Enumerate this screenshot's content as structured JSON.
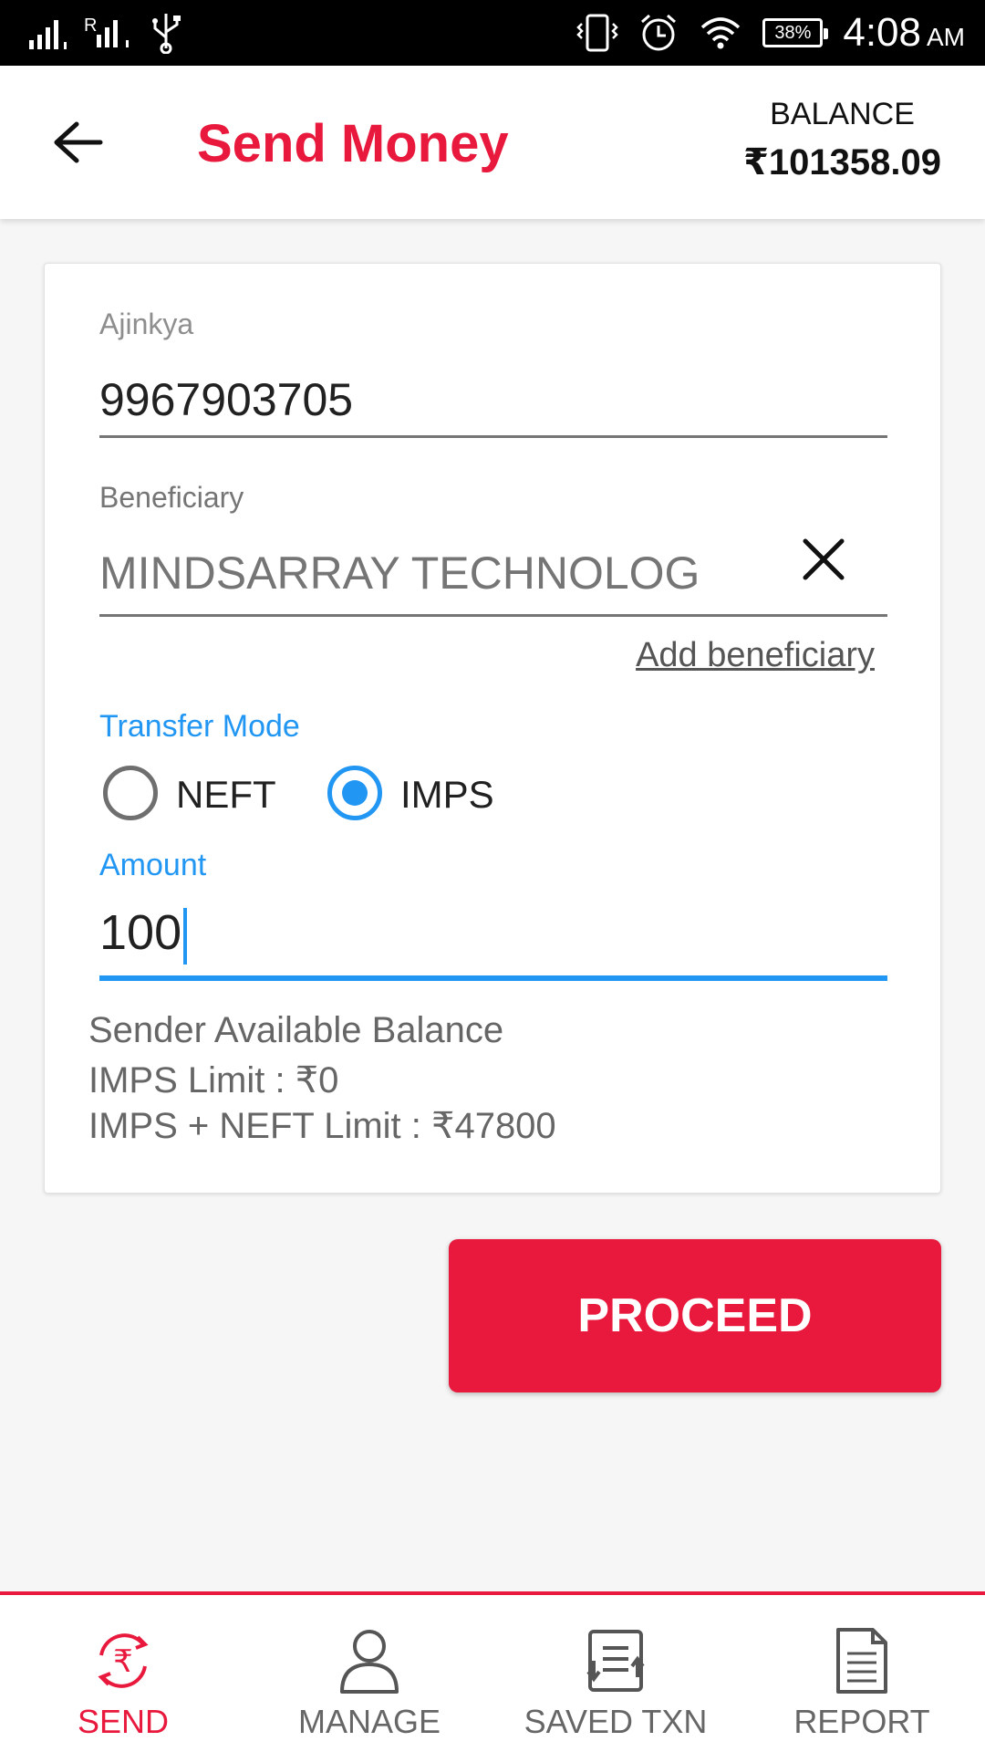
{
  "status_bar": {
    "battery": "38%",
    "time": "4:08",
    "ampm": "AM"
  },
  "app_bar": {
    "title": "Send Money",
    "balance_label": "BALANCE",
    "balance_value": "₹101358.09"
  },
  "form": {
    "sender_label": "Ajinkya",
    "sender_value": "9967903705",
    "beneficiary_label": "Beneficiary",
    "beneficiary_value": "MINDSARRAY TECHNOLOG",
    "add_beneficiary": "Add beneficiary",
    "transfer_mode_label": "Transfer Mode",
    "modes": [
      {
        "label": "NEFT",
        "selected": false
      },
      {
        "label": "IMPS",
        "selected": true
      }
    ],
    "amount_label": "Amount",
    "amount_value": "100"
  },
  "info": {
    "heading": "Sender Available Balance",
    "imps_limit": "IMPS Limit : ₹0",
    "imps_neft_limit": "IMPS + NEFT Limit : ₹47800"
  },
  "proceed_label": "PROCEED",
  "bottom_nav": [
    {
      "label": "SEND",
      "icon": "rupee-exchange-icon",
      "active": true
    },
    {
      "label": "MANAGE",
      "icon": "user-icon",
      "active": false
    },
    {
      "label": "SAVED TXN",
      "icon": "saved-list-icon",
      "active": false
    },
    {
      "label": "REPORT",
      "icon": "document-icon",
      "active": false
    }
  ],
  "colors": {
    "brand": "#e8193c",
    "accent": "#2196f3"
  }
}
